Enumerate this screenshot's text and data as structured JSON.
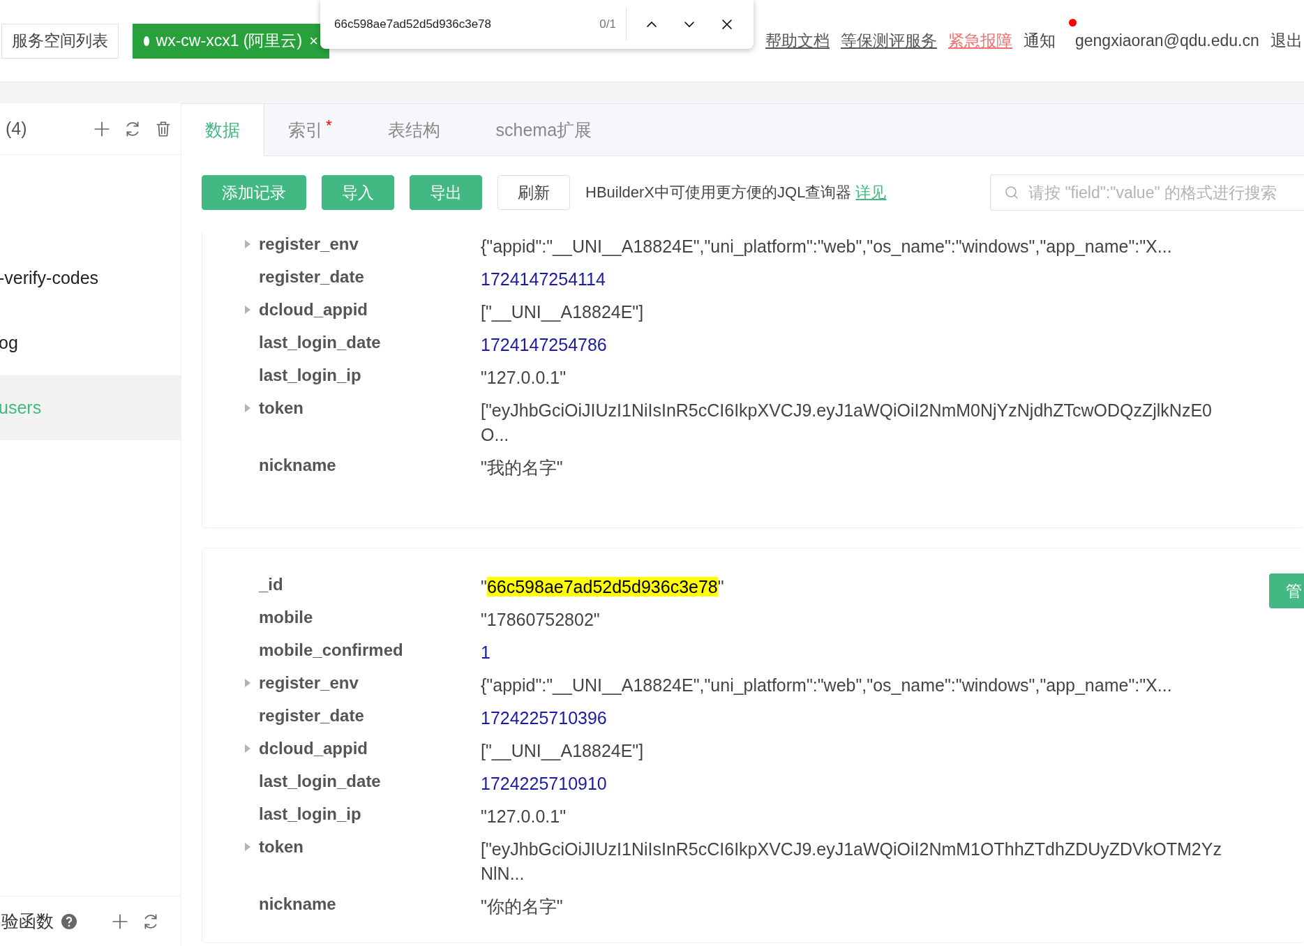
{
  "topbar": {
    "space_list_button": "服务空间列表",
    "space_tab": {
      "label": "wx-cw-xcx1 (阿里云)",
      "close": "×"
    },
    "links": [
      {
        "label": "帮助文档",
        "kind": "plain"
      },
      {
        "label": "等保测评服务",
        "kind": "plain"
      },
      {
        "label": "紧急报障",
        "kind": "alert"
      }
    ],
    "notice": {
      "label": "通知",
      "unread": true
    },
    "user": "gengxiaoran@qdu.edu.cn",
    "logout": "退出"
  },
  "find_bar": {
    "query": "66c598ae7ad52d5d936c3e78",
    "count": "0/1"
  },
  "sidebar": {
    "header": "(4)",
    "items": [
      {
        "label": "-verify-codes",
        "selected": false
      },
      {
        "label": "og",
        "selected": false
      },
      {
        "label": "users",
        "selected": true
      }
    ],
    "footer": "验函数"
  },
  "tabs": [
    {
      "label": "数据",
      "selected": true,
      "required": false
    },
    {
      "label": "索引",
      "selected": false,
      "required": true,
      "marker": "*"
    },
    {
      "label": "表结构",
      "selected": false,
      "required": false
    },
    {
      "label": "schema扩展",
      "selected": false,
      "required": false
    }
  ],
  "toolbar": {
    "buttons": [
      {
        "label": "添加记录",
        "kind": "primary"
      },
      {
        "label": "导入",
        "kind": "primary"
      },
      {
        "label": "导出",
        "kind": "primary"
      },
      {
        "label": "刷新",
        "kind": "plain"
      }
    ],
    "hint": "HBuilderX中可使用更方便的JQL查询器",
    "hint_link": "详见",
    "search_placeholder": "请按 \"field\":\"value\" 的格式进行搜索"
  },
  "records": [
    {
      "fields": [
        {
          "key": "register_env",
          "value": "{\"appid\":\"__UNI__A18824E\",\"uni_platform\":\"web\",\"os_name\":\"windows\",\"app_name\":\"X...",
          "kind": "string",
          "expandable": true
        },
        {
          "key": "register_date",
          "value": "1724147254114",
          "kind": "number",
          "expandable": false
        },
        {
          "key": "dcloud_appid",
          "value": "[\"__UNI__A18824E\"]",
          "kind": "string",
          "expandable": true
        },
        {
          "key": "last_login_date",
          "value": "1724147254786",
          "kind": "number",
          "expandable": false
        },
        {
          "key": "last_login_ip",
          "value": "\"127.0.0.1\"",
          "kind": "string",
          "expandable": false
        },
        {
          "key": "token",
          "value": "[\"eyJhbGciOiJIUzI1NiIsInR5cCI6IkpXVCJ9.eyJ1aWQiOiI2NmM0NjYzNjdhZTcwODQzZjlkNzE0O...",
          "kind": "string",
          "expandable": true
        },
        {
          "key": "nickname",
          "value": "\"我的名字\"",
          "kind": "string",
          "expandable": false
        }
      ]
    },
    {
      "manage_button": "管",
      "fields": [
        {
          "key": "_id",
          "value_parts": [
            {
              "text": "\"",
              "highlighted": false
            },
            {
              "text": "66c598ae7ad52d5d936c3e78",
              "highlighted": true
            },
            {
              "text": "\"",
              "highlighted": false
            }
          ],
          "kind": "string",
          "expandable": false
        },
        {
          "key": "mobile",
          "value": "\"17860752802\"",
          "kind": "string",
          "expandable": false
        },
        {
          "key": "mobile_confirmed",
          "value": "1",
          "kind": "number",
          "expandable": false
        },
        {
          "key": "register_env",
          "value": "{\"appid\":\"__UNI__A18824E\",\"uni_platform\":\"web\",\"os_name\":\"windows\",\"app_name\":\"X...",
          "kind": "string",
          "expandable": true
        },
        {
          "key": "register_date",
          "value": "1724225710396",
          "kind": "number",
          "expandable": false
        },
        {
          "key": "dcloud_appid",
          "value": "[\"__UNI__A18824E\"]",
          "kind": "string",
          "expandable": true
        },
        {
          "key": "last_login_date",
          "value": "1724225710910",
          "kind": "number",
          "expandable": false
        },
        {
          "key": "last_login_ip",
          "value": "\"127.0.0.1\"",
          "kind": "string",
          "expandable": false
        },
        {
          "key": "token",
          "value": "[\"eyJhbGciOiJIUzI1NiIsInR5cCI6IkpXVCJ9.eyJ1aWQiOiI2NmM1OThhZTdhZDUyZDVkOTM2YzNlN...",
          "kind": "string",
          "expandable": true
        },
        {
          "key": "nickname",
          "value": "\"你的名字\"",
          "kind": "string",
          "expandable": false
        }
      ]
    }
  ]
}
